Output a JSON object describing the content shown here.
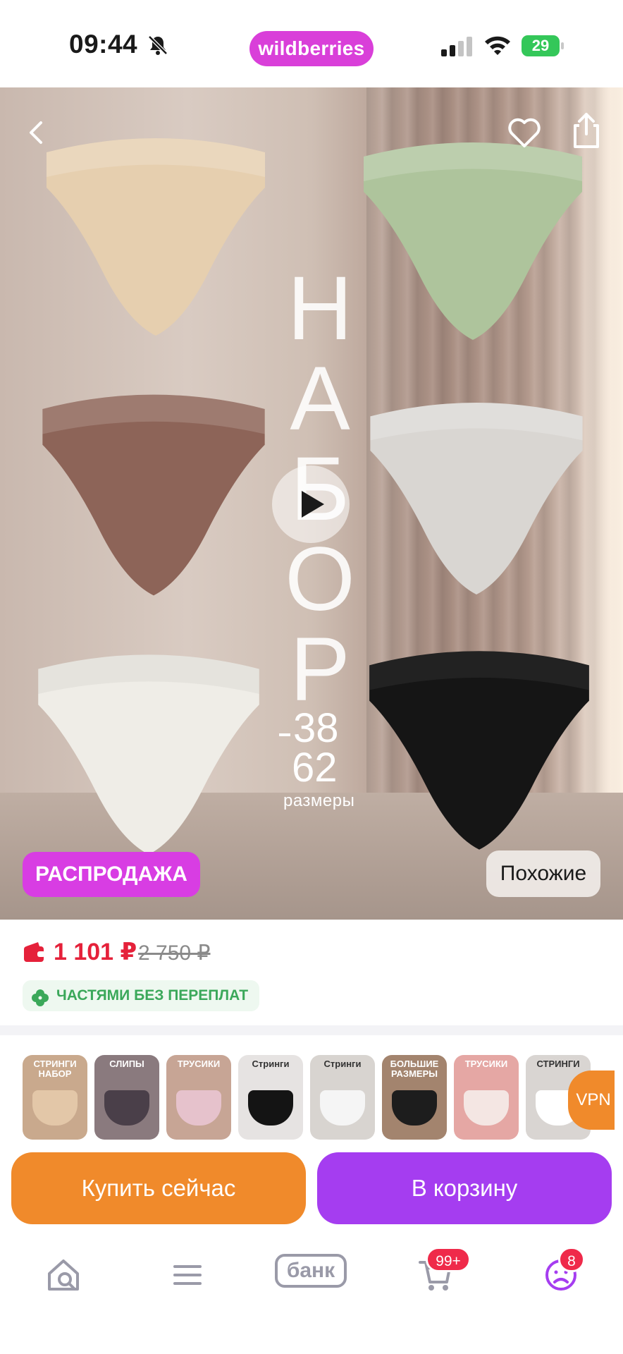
{
  "status_bar": {
    "time": "09:44",
    "brand": "wildberries",
    "battery": "29"
  },
  "hero": {
    "title_letters": [
      "Н",
      "А",
      "Б",
      "О",
      "Р"
    ],
    "size_from": "38",
    "size_to": "62",
    "size_caption": "размеры",
    "sale_badge": "РАСПРОДАЖА",
    "similar_button": "Похожие",
    "product_colors": [
      "#e6cfaf",
      "#aec49c",
      "#8d6458",
      "#d9d6d2",
      "#efede7",
      "#151515"
    ]
  },
  "price": {
    "current": "1 101 ₽",
    "old": "2 750 ₽",
    "installment": "ЧАСТЯМИ БЕЗ ПЕРЕПЛАТ"
  },
  "thumbnails": [
    {
      "label": "СТРИНГИ\nНАБОР",
      "bg": "#c9a98d",
      "shape": "#e3c7a8"
    },
    {
      "label": "СЛИПЫ",
      "bg": "#8a7a7e",
      "shape": "#4a3f49"
    },
    {
      "label": "ТРУСИКИ",
      "bg": "#c7a595",
      "shape": "#e6c2cc"
    },
    {
      "label": "Стринги",
      "bg": "#e6e3e2",
      "shape": "#141414"
    },
    {
      "label": "Стринги",
      "bg": "#d8d4d0",
      "shape": "#f5f5f5"
    },
    {
      "label": "БОЛЬШИЕ РАЗМЕРЫ",
      "bg": "#a3846e",
      "shape": "#1d1d1d"
    },
    {
      "label": "ТРУСИКИ",
      "bg": "#e5a7a4",
      "shape": "#f4e6e3"
    },
    {
      "label": "СТРИНГИ",
      "bg": "#d9d5d2",
      "shape": "#ffffff"
    }
  ],
  "vpn_label": "VPN",
  "actions": {
    "buy_now": "Купить сейчас",
    "add_to_cart": "В корзину"
  },
  "tabbar": {
    "bank_label": "банк",
    "cart_badge": "99+",
    "profile_badge": "8"
  },
  "colors": {
    "brand": "#d93fd9",
    "price_red": "#e5213a",
    "buy_orange": "#f08a2b",
    "cart_purple": "#a53df0",
    "installment_green": "#3ba85a"
  }
}
